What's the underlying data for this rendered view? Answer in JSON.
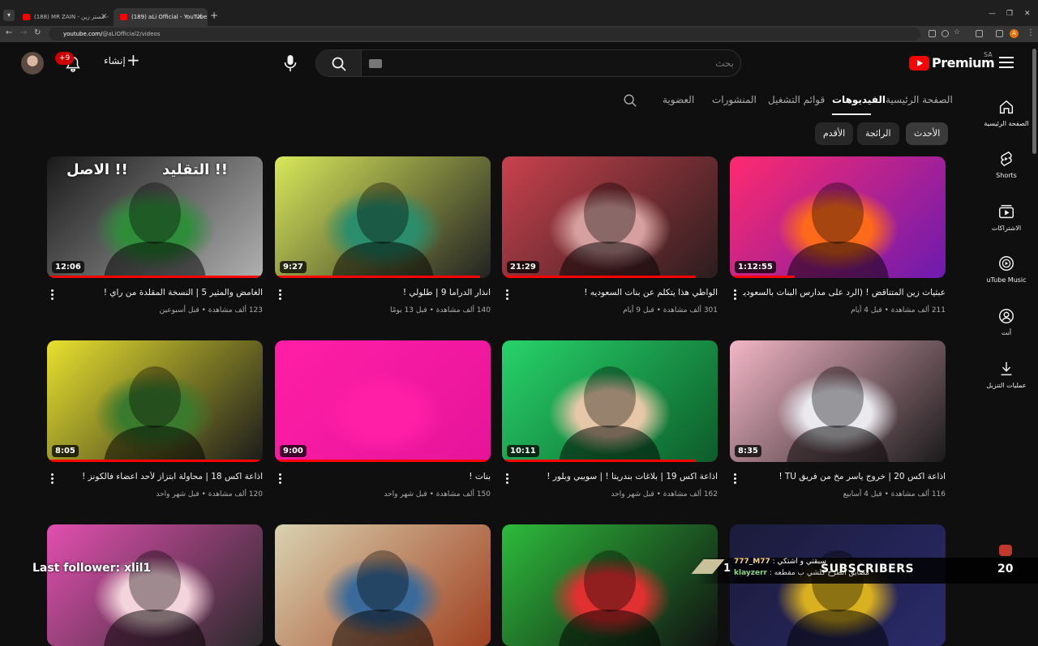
{
  "browser": {
    "tabs": [
      {
        "title": "(188) MR ZAIN - مستر زين - YouTube"
      },
      {
        "title": "(189) aLi Official - YouTube"
      }
    ],
    "url_prefix": "youtube.com/",
    "url_path": "@aLiOfficial2/videos"
  },
  "header": {
    "notification_count": "+9",
    "create_label": "إنشاء",
    "search_placeholder": "بحث",
    "logo_text": "Premium",
    "country_code": "SA"
  },
  "guide": [
    {
      "label": "الصفحة الرئيسية",
      "icon": "home-icon"
    },
    {
      "label": "Shorts",
      "icon": "shorts-icon"
    },
    {
      "label": "الاشتراكات",
      "icon": "subscriptions-icon"
    },
    {
      "label": "uTube Music",
      "icon": "music-icon"
    },
    {
      "label": "أنت",
      "icon": "you-icon"
    },
    {
      "label": "عمليات التنزيل",
      "icon": "download-icon"
    }
  ],
  "channel_tabs": [
    "الصفحة الرئيسية",
    "الفيديوهات",
    "قوائم التشغيل",
    "المنشورات",
    "العضوية"
  ],
  "chips": [
    "الأحدث",
    "الرائجة",
    "الأقدم"
  ],
  "videos": [
    {
      "title": "عبثيات زين المتناقض ! (الرد على مدارس البنات بالسعودية)",
      "meta": "211 ألف مشاهدة • قبل 4 أيام",
      "duration": "1:12:55",
      "progress": 0.3,
      "colors": [
        "#ff2a6e",
        "#ff6a1a",
        "#6c1bb0"
      ]
    },
    {
      "title": "الواطي هذا يتكلم عن بنات السعوديه !",
      "meta": "301 ألف مشاهدة • قبل 9 أيام",
      "duration": "21:29",
      "progress": 0.9,
      "colors": [
        "#c9414d",
        "#d6a0a0",
        "#2b1d1d"
      ]
    },
    {
      "title": "انذار الدراما 9 | طلولي !",
      "meta": "140 ألف مشاهدة • قبل 13 يومًا",
      "duration": "9:27",
      "progress": 0.95,
      "colors": [
        "#d8e85a",
        "#2a8d6c",
        "#222"
      ]
    },
    {
      "title": "الغامض والمثير 5 | النسخة المقلدة من راي !",
      "meta": "123 ألف مشاهدة • قبل أسبوعين",
      "duration": "12:06",
      "progress": 1.0,
      "colors": [
        "#1a1a1a",
        "#2f8d3a",
        "#b0b0b0"
      ]
    },
    {
      "title": "اذاعة اكس 20 | خروج ياسر مخ من فريق TU !",
      "meta": "116 ألف مشاهدة • قبل 4 أسابيع",
      "duration": "8:35",
      "progress": 0.0,
      "colors": [
        "#f3b6c7",
        "#e9e9ee",
        "#1a1a1a"
      ]
    },
    {
      "title": "اذاعة اكس 19 | بلاغات بندريتا ! | سويبي وبلور !",
      "meta": "162 ألف مشاهدة • قبل شهر واحد",
      "duration": "10:11",
      "progress": 0.9,
      "colors": [
        "#27d36a",
        "#e6c8a8",
        "#0d5c2a"
      ]
    },
    {
      "title": "بنات !",
      "meta": "150 ألف مشاهدة • قبل شهر واحد",
      "duration": "9:00",
      "progress": 1.0,
      "colors": [
        "#ff1fa6",
        "#ff1fa6",
        "#e6149a"
      ]
    },
    {
      "title": "اذاعة اكس 18 | محاولة ابتزاز لأحد اعضاء فالكونز !",
      "meta": "120 ألف مشاهدة • قبل شهر واحد",
      "duration": "8:05",
      "progress": 1.0,
      "colors": [
        "#e8e12f",
        "#3a7a2c",
        "#1b1b1b"
      ]
    },
    {
      "title": "",
      "meta": "",
      "duration": "",
      "progress": 0,
      "colors": [
        "#1b1b3a",
        "#d9b020",
        "#2a2a6a"
      ]
    },
    {
      "title": "",
      "meta": "",
      "duration": "",
      "progress": 0,
      "colors": [
        "#2dbb3b",
        "#e03030",
        "#111"
      ]
    },
    {
      "title": "",
      "meta": "",
      "duration": "",
      "progress": 0,
      "colors": [
        "#d9d2b0",
        "#3a6a9a",
        "#a04020"
      ]
    },
    {
      "title": "",
      "meta": "",
      "duration": "",
      "progress": 0,
      "colors": [
        "#e24fb0",
        "#f4d4dc",
        "#2a2a2a"
      ]
    }
  ],
  "thumb_texts": {
    "tradition_left": "التقليد",
    "tradition_right": "الاصل",
    "marks": "!!"
  },
  "stream_overlay": {
    "last_follower": "Last follower: xlil1",
    "count_one": "1",
    "chat_user1": "777_M77",
    "chat_msg1": "سبقتي و اشتكي",
    "chat_user2": "klayzerr",
    "chat_msg2": "مضايق اتطرح كلشي ب مقطعه",
    "subscribers_label": "SUBSCRIBERS",
    "subscribers_count": "20"
  },
  "accent_color": "#ff0000"
}
